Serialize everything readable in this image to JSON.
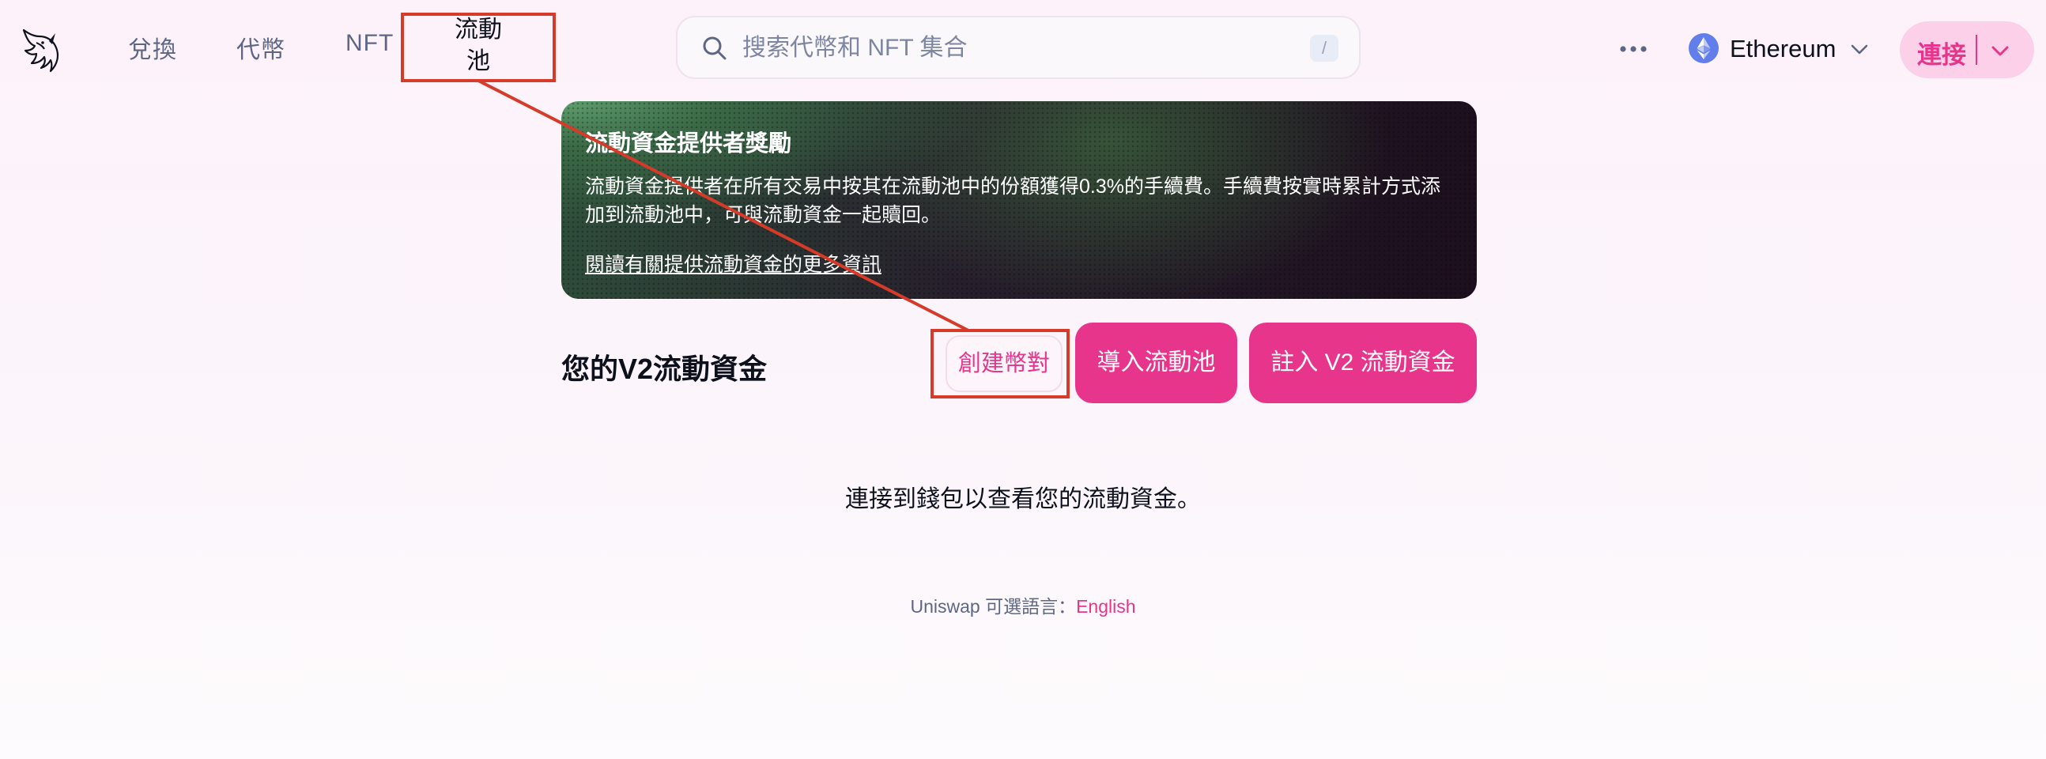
{
  "nav": {
    "links": [
      {
        "label": "兌換"
      },
      {
        "label": "代幣"
      },
      {
        "label": "NFT"
      }
    ],
    "pool_label_line1": "流動",
    "pool_label_line2": "池"
  },
  "search": {
    "placeholder": "搜索代幣和 NFT 集合",
    "shortcut": "/"
  },
  "network": {
    "label": "Ethereum",
    "icon": "ethereum-icon"
  },
  "connect": {
    "label": "連接"
  },
  "banner": {
    "title": "流動資金提供者獎勵",
    "description": "流動資金提供者在所有交易中按其在流動池中的份額獲得0.3%的手續費。手續費按實時累計方式添加到流動池中，可與流動資金一起贖回。",
    "link": "閱讀有關提供流動資金的更多資訊"
  },
  "section": {
    "title": "您的V2流動資金",
    "create_pair": "創建幣對",
    "import_pool": "導入流動池",
    "migrate": "註入 V2 流動資金"
  },
  "empty_message": "連接到錢包以查看您的流動資金。",
  "footer": {
    "prefix": "Uniswap 可選語言：",
    "language_link": "English"
  },
  "colors": {
    "accent": "#e8358c",
    "accent_soft": "#fbd0e8",
    "annotation": "#d63b2a",
    "text_primary": "#0d111c",
    "text_secondary": "#5d6785"
  }
}
